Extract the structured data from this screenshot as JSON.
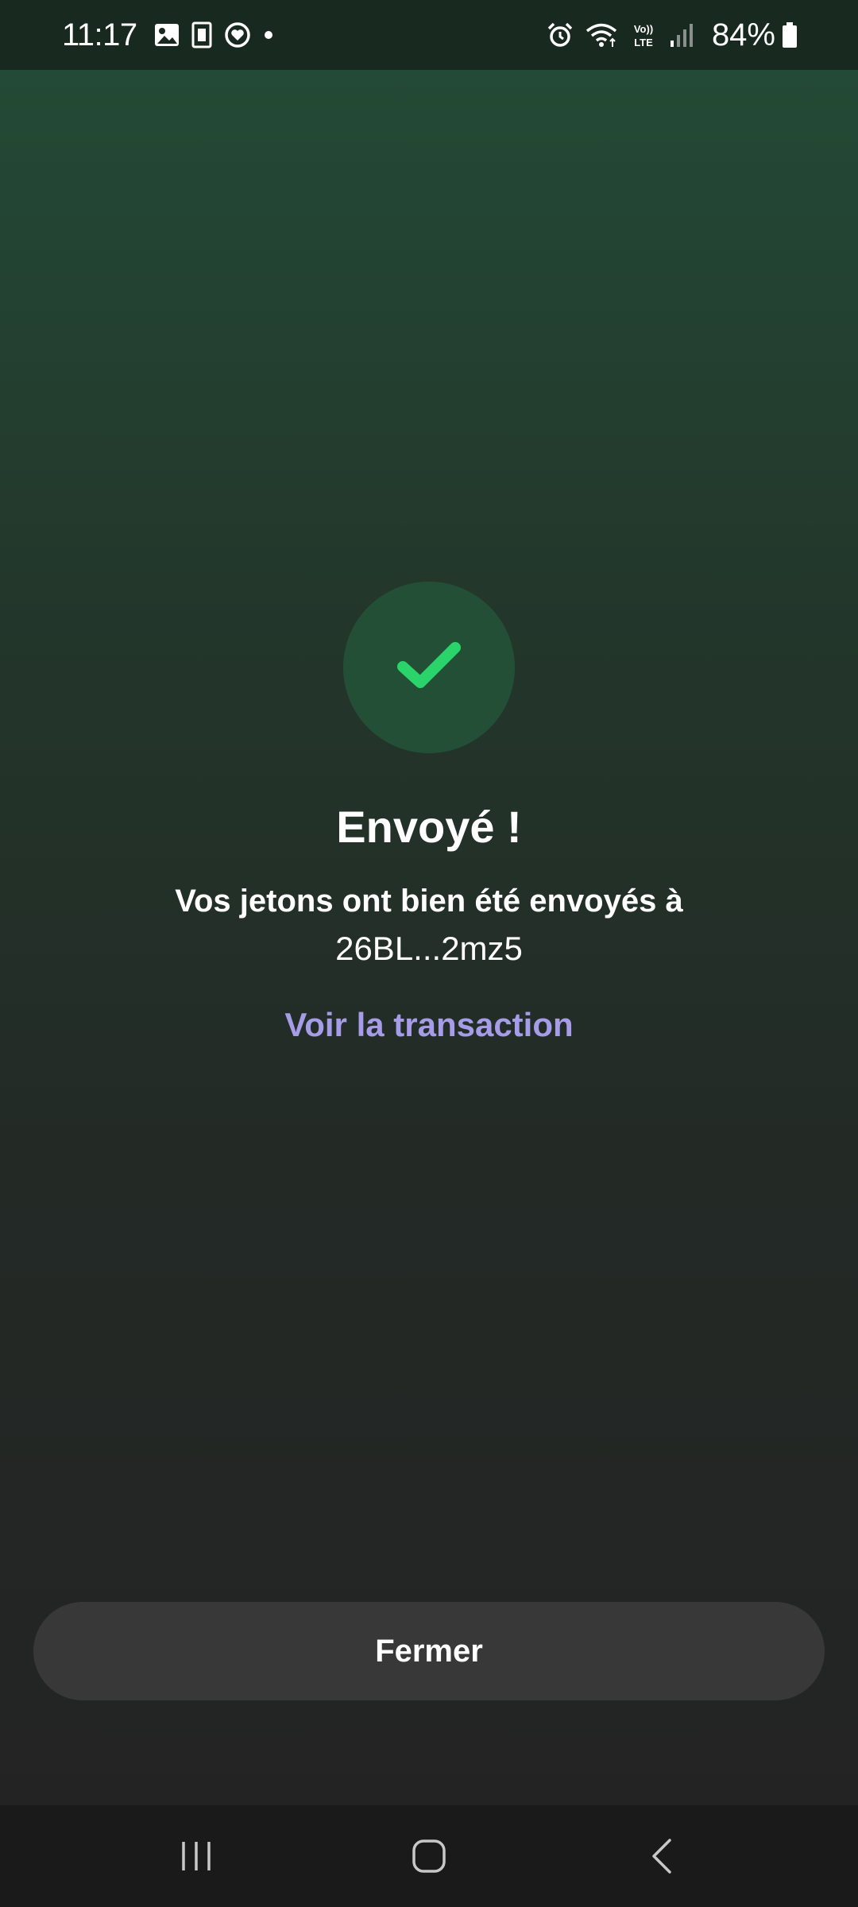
{
  "status_bar": {
    "time": "11:17",
    "battery_percent": "84%",
    "left_icons": [
      "gallery-icon",
      "card-icon",
      "health-icon",
      "notification-dot-icon"
    ],
    "right_icons": [
      "alarm-icon",
      "wifi-icon",
      "volte-icon",
      "signal-icon",
      "battery-icon"
    ],
    "volte_label_top": "Vo))",
    "volte_label_bottom": "LTE"
  },
  "main": {
    "status_icon": "check-icon",
    "title": "Envoyé !",
    "message": "Vos jetons ont bien été envoyés à",
    "address": "26BL...2mz5",
    "view_transaction_label": "Voir la transaction"
  },
  "footer": {
    "close_label": "Fermer"
  },
  "nav_bar": {
    "buttons": [
      "recents-icon",
      "home-icon",
      "back-icon"
    ]
  },
  "colors": {
    "accent_green": "#2bd46a",
    "link_purple": "#a79ce8",
    "circle_bg": "#234f37",
    "button_bg": "#383838"
  }
}
